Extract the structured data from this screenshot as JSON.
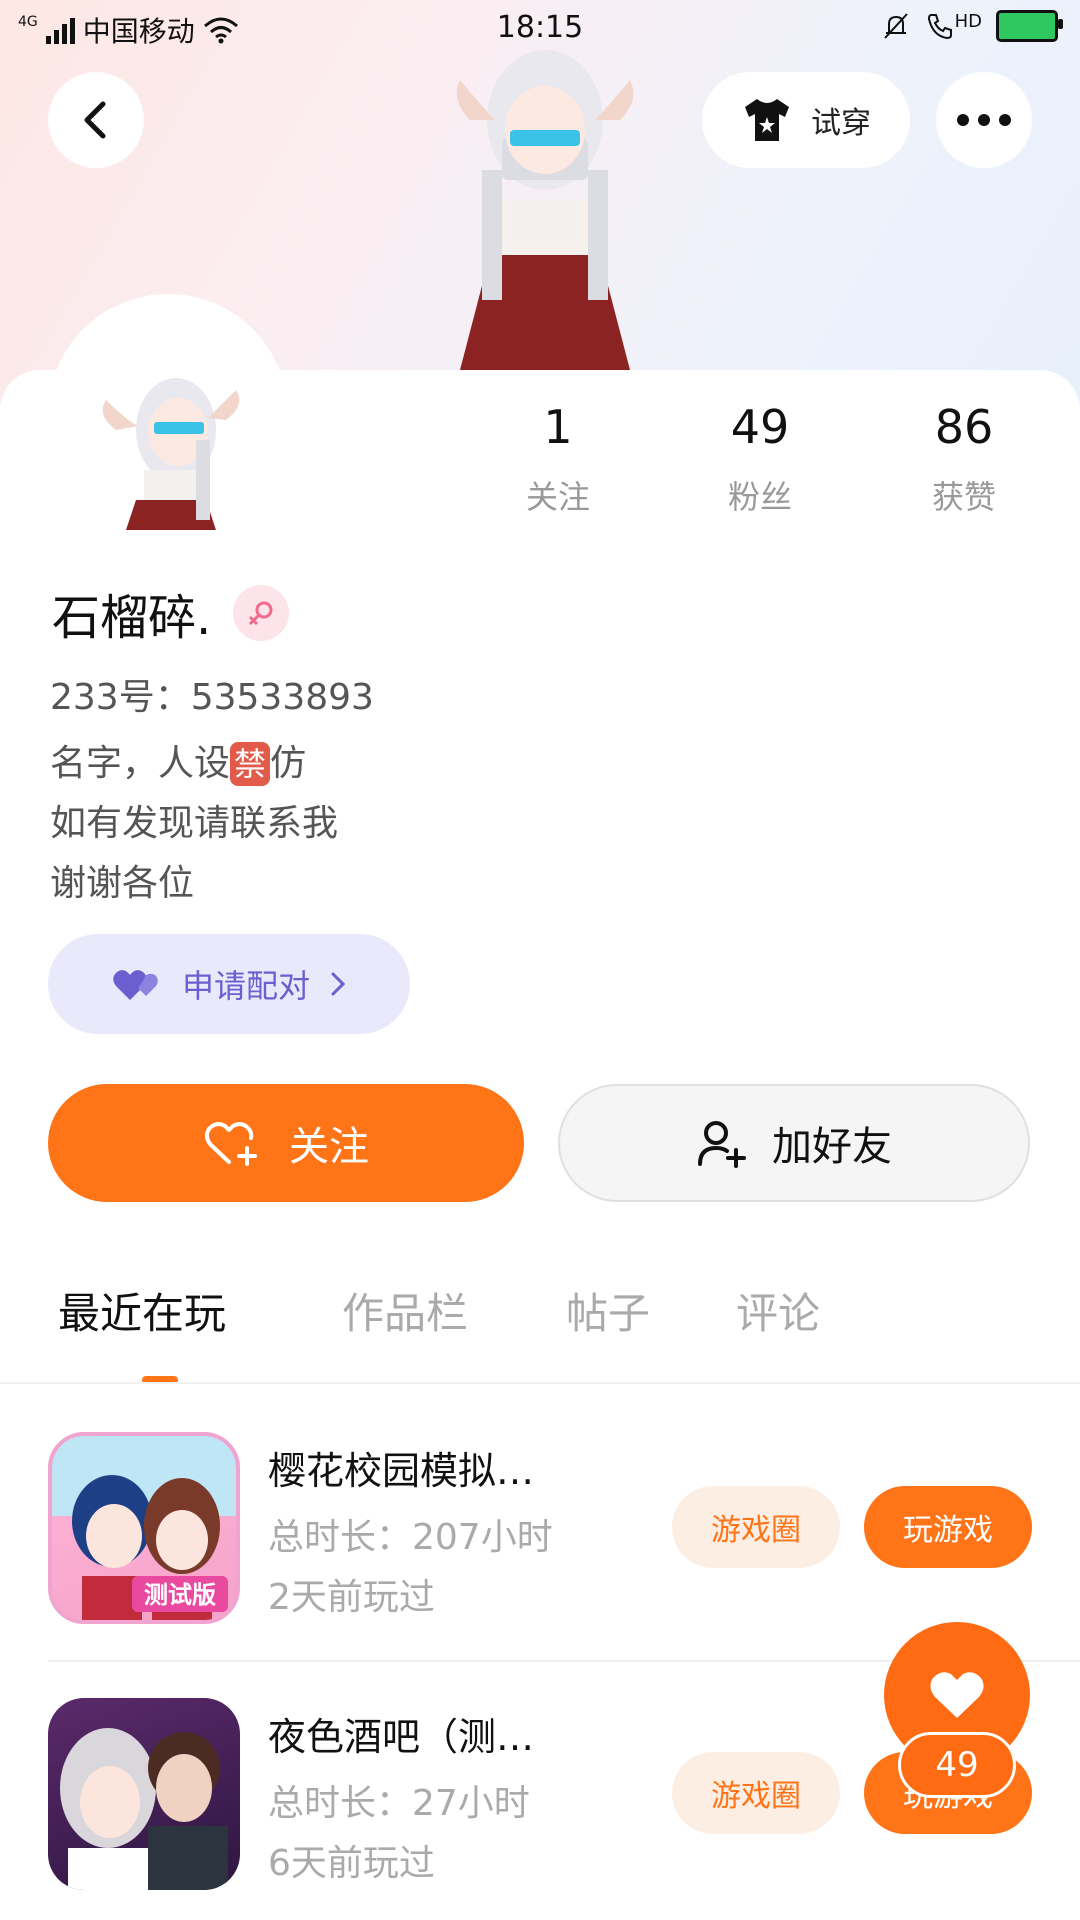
{
  "statusbar": {
    "network": "4G",
    "carrier": "中国移动",
    "time": "18:15",
    "hd": "HD"
  },
  "header": {
    "try_on_label": "试穿"
  },
  "profile": {
    "stats": [
      {
        "value": "1",
        "label": "关注"
      },
      {
        "value": "49",
        "label": "粉丝"
      },
      {
        "value": "86",
        "label": "获赞"
      }
    ],
    "name": "石榴碎.",
    "id_line": "233号：53533893",
    "bio_line1_a": "名字，人设",
    "bio_ban": "禁",
    "bio_line1_b": "仿",
    "bio_line2": "如有发现请联系我",
    "bio_line3": "谢谢各位",
    "pair_label": "申请配对"
  },
  "actions": {
    "follow_label": "关注",
    "add_friend_label": "加好友"
  },
  "tabs": [
    {
      "label": "最近在玩",
      "active": true
    },
    {
      "label": "作品栏",
      "active": false
    },
    {
      "label": "帖子",
      "active": false
    },
    {
      "label": "评论",
      "active": false
    }
  ],
  "games": [
    {
      "title": "樱花校园模拟…",
      "duration": "总时长：207小时",
      "last_played": "2天前玩过",
      "icon_badge": "测试版",
      "circle_label": "游戏圈",
      "play_label": "玩游戏"
    },
    {
      "title": "夜色酒吧（测…",
      "duration": "总时长：27小时",
      "last_played": "6天前玩过",
      "circle_label": "游戏圈",
      "play_label": "玩游戏"
    }
  ],
  "fab": {
    "count": "49"
  },
  "colors": {
    "accent": "#ff7417",
    "pair_bg": "#eae8fb",
    "pair_text": "#6b5fd0"
  }
}
